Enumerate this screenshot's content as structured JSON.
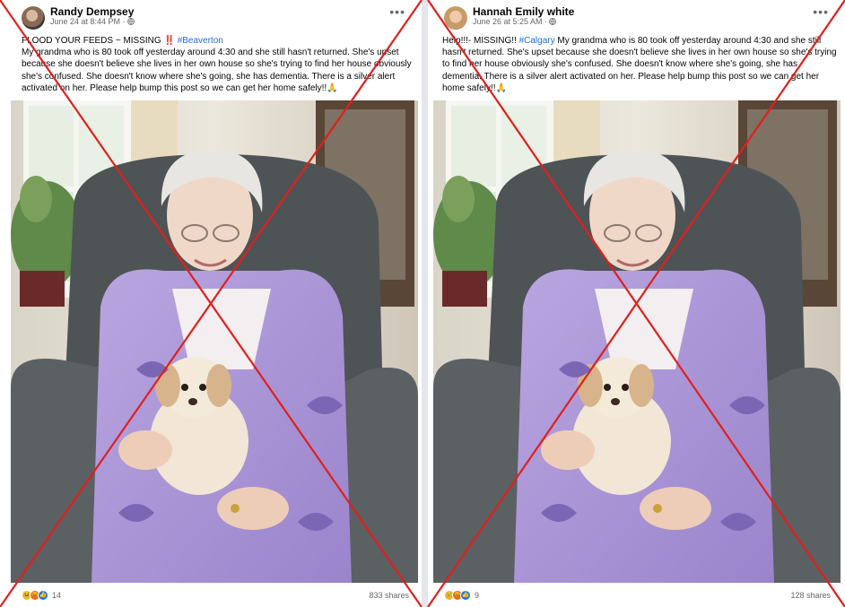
{
  "posts": [
    {
      "author": "Randy Dempsey",
      "timestamp": "June 24 at 8:44 PM · ",
      "privacy_icon": "globe-icon",
      "text_prefix": "FLOOD YOUR FEEDS ~ MISSING ",
      "text_emoji": "‼️",
      "hashtag": "#Beaverton",
      "text_body": "My grandma who is 80 took off yesterday around 4:30 and she still hasn't returned. She's upset because she doesn't believe she lives in her own house so she's trying to find her house obviously she's confused. She doesn't know where she's going, she has dementia. There is a silver alert activated on her. Please help bump this post so we can get her home safely!!🙏",
      "reaction_icons": [
        "haha-icon",
        "angry-icon",
        "like-icon"
      ],
      "reaction_count": "14",
      "shares": "833 shares"
    },
    {
      "author": "Hannah Emily white",
      "timestamp": "June 26 at 5:25 AM · ",
      "privacy_icon": "globe-icon",
      "text_prefix": "Help!!!- MISSING!! ",
      "hashtag": "#Calgary",
      "text_body": " My grandma who is 80 took off yesterday around 4:30 and she still hasn't returned. She's upset because she doesn't believe she lives in her own house so she's trying to find her house obviously she's confused. She doesn't know where she's going, she has dementia. There is a silver alert activated on her. Please help bump this post so we can get her home safely!!🙏",
      "reaction_icons": [
        "sad-icon",
        "angry-icon",
        "like-icon"
      ],
      "reaction_count": "9",
      "shares": "128 shares"
    }
  ],
  "overlay": {
    "cross_color": "#e0201c",
    "meaning": "red-x-cross-icon"
  }
}
